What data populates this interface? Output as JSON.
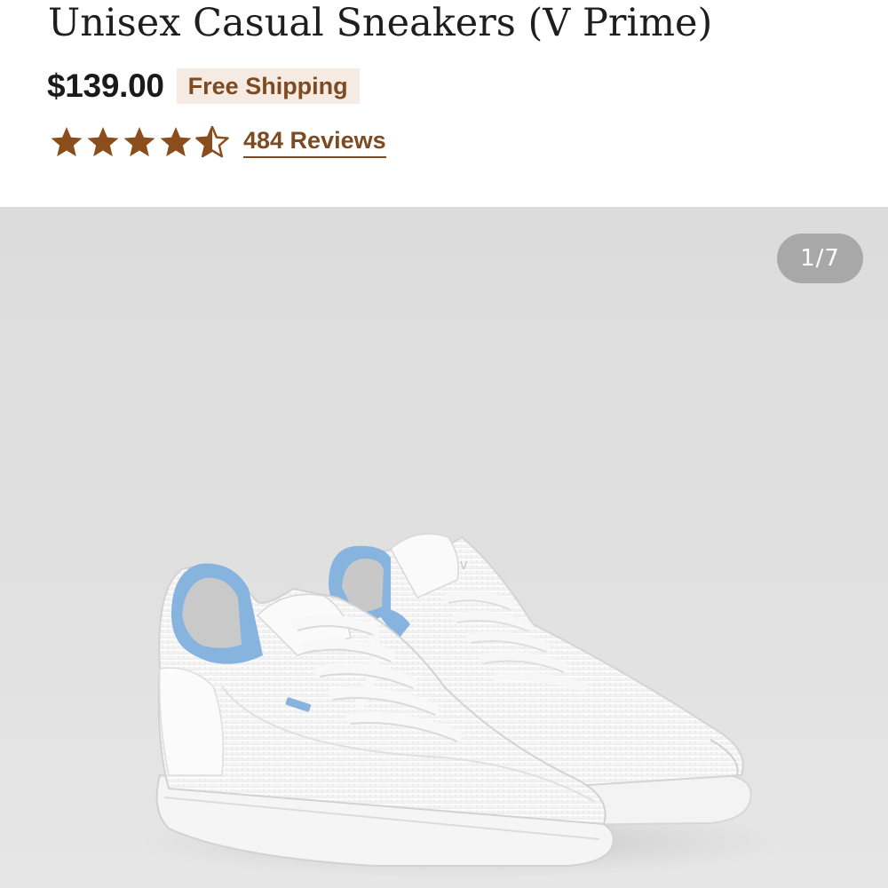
{
  "product": {
    "title": "Unisex Casual Sneakers (V Prime)",
    "price": "$139.00",
    "shipping_badge": "Free Shipping",
    "rating": 4.5,
    "rating_max": 5,
    "reviews_link": "484 Reviews"
  },
  "gallery": {
    "counter": "1/7",
    "current_image": 1,
    "total_images": 7
  },
  "colors": {
    "accent_brown": "#7d4a22",
    "star_brown": "#8a4e1c",
    "badge_bg": "#f6ebe3",
    "gallery_bg": "#dfdfdf",
    "counter_bg": "#a8a8a8",
    "sneaker_collar_blue": "#86b4df"
  },
  "icons": {
    "star": "star-icon",
    "half_star": "half-star-icon"
  }
}
